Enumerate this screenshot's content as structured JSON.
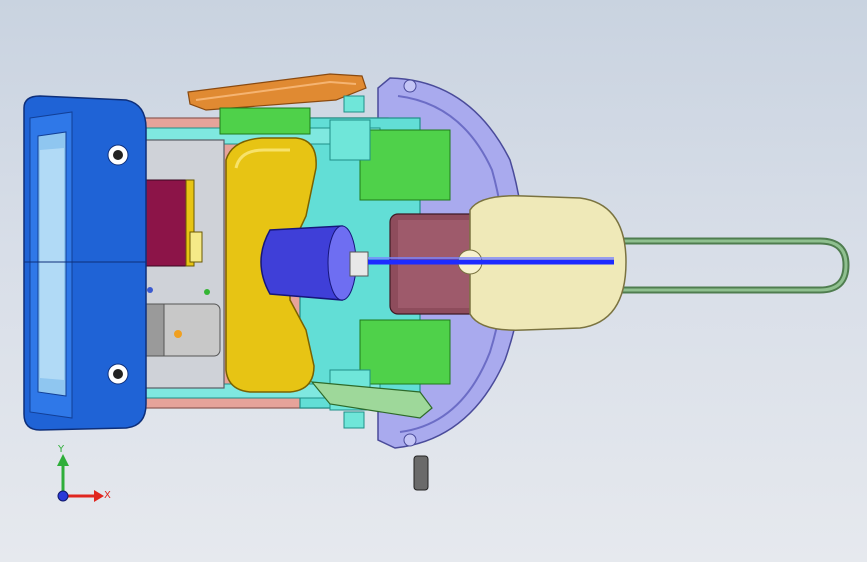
{
  "viewport": {
    "background_top": "#c9d3e0",
    "background_bottom": "#e6e9ee"
  },
  "triad": {
    "y_label": "Y",
    "x_label": "X",
    "y_color": "#2fae3a",
    "x_color": "#e0261f",
    "z_color": "#2a39d8"
  },
  "model": {
    "part_colors": {
      "cap_blue": "#1f63d6",
      "cap_blue_dark": "#123f96",
      "housing_salmon": "#e6a39a",
      "frame_gray": "#c9ccd2",
      "pcb_maroon": "#8c1448",
      "yellow_shell": "#e7c414",
      "yellow_dark": "#b69200",
      "cyan_plate": "#5fe0d8",
      "green_plate": "#4fd14a",
      "orange_arm": "#e08a32",
      "lavender_ring": "#9d9ee8",
      "roller_blue": "#3f3fd8",
      "motor_maroon": "#8e4c5c",
      "cream_head": "#efe9b8",
      "handle_green": "#6c9a6c",
      "shaft_blue": "#1d2bff"
    }
  }
}
